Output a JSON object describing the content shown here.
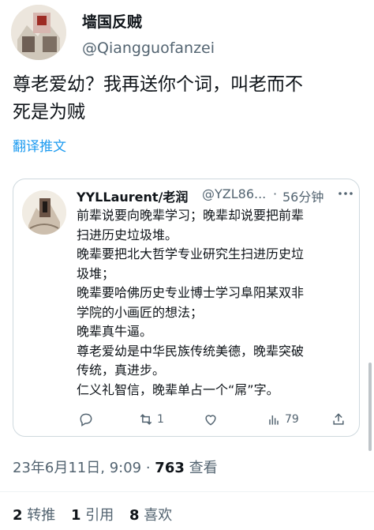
{
  "tweet": {
    "author_name": "墙国反贼",
    "author_handle": "@Qiangguofanzei",
    "text_lines": [
      "尊老爱幼？我再送你个词，叫老而不",
      "死是为贼"
    ],
    "translate_label": "翻译推文"
  },
  "quote": {
    "author_name": "YYLLaurent/老润",
    "author_handle": "@YZL86...",
    "separator": "·",
    "time": "56分钟",
    "lines": [
      "前辈说要向晚辈学习；晚辈却说要把前辈",
      "扫进历史垃圾堆。",
      "晚辈要把北大哲学专业研究生扫进历史垃",
      "圾堆；",
      "晚辈要哈佛历史专业博士学习阜阳某双非",
      "学院的小画匠的想法；",
      "晚辈真牛逼。",
      "尊老爱幼是中华民族传统美德，晚辈突破",
      "传统，真进步。",
      "仁义礼智信，晚辈单占一个“屌”字。"
    ],
    "actions": {
      "retweet_count": "1",
      "views_count": "79"
    }
  },
  "meta": {
    "timestamp": "23年6月11日, 9:09 · ",
    "views_number": "763",
    "views_label": " 查看"
  },
  "stats": {
    "retweets_number": "2",
    "retweets_label": " 转推",
    "quotes_number": "1",
    "quotes_label": " 引用",
    "likes_number": "8",
    "likes_label": " 喜欢"
  },
  "icons": [
    "reply-icon",
    "retweet-icon",
    "like-icon",
    "views-icon",
    "share-icon",
    "more-icon"
  ],
  "colors": {
    "link": "#1d9bf0",
    "secondary_text": "#536471",
    "border": "#cfd9de"
  }
}
